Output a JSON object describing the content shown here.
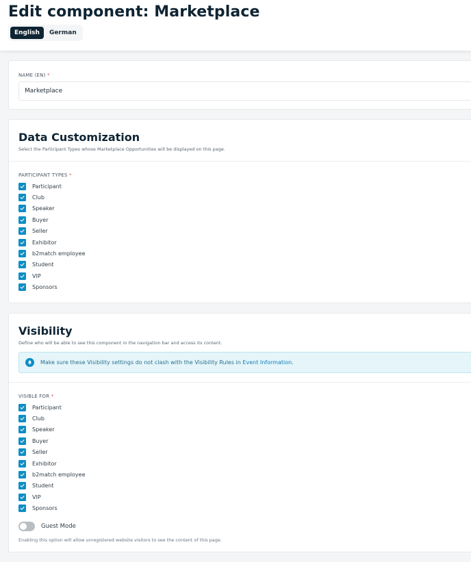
{
  "header": {
    "title": "Edit component: Marketplace",
    "languages": [
      {
        "label": "English",
        "active": true
      },
      {
        "label": "German",
        "active": false
      }
    ]
  },
  "name_field": {
    "label": "NAME (EN)",
    "required_mark": "*",
    "value": "Marketplace"
  },
  "data_customization": {
    "title": "Data Customization",
    "description": "Select the Participant Types whose Marketplace Opportunities will be displayed on this page.",
    "field_label": "PARTICIPANT TYPES",
    "required_mark": "*",
    "items": [
      {
        "label": "Participant",
        "checked": true
      },
      {
        "label": "Club",
        "checked": true
      },
      {
        "label": "Speaker",
        "checked": true
      },
      {
        "label": "Buyer",
        "checked": true
      },
      {
        "label": "Seller",
        "checked": true
      },
      {
        "label": "Exhibitor",
        "checked": true
      },
      {
        "label": "b2match employee",
        "checked": true
      },
      {
        "label": "Student",
        "checked": true
      },
      {
        "label": "VIP",
        "checked": true
      },
      {
        "label": "Sponsors",
        "checked": true
      }
    ]
  },
  "visibility": {
    "title": "Visibility",
    "description": "Define who will be able to see this component in the navigation bar and access its content.",
    "alert": {
      "icon": "bell-icon",
      "text": "Make sure these Visibility settings do not clash with the Visibility Rules in ",
      "link": "Event Information",
      "suffix": "."
    },
    "field_label": "VISIBLE FOR",
    "required_mark": "*",
    "items": [
      {
        "label": "Participant",
        "checked": true
      },
      {
        "label": "Club",
        "checked": true
      },
      {
        "label": "Speaker",
        "checked": true
      },
      {
        "label": "Buyer",
        "checked": true
      },
      {
        "label": "Seller",
        "checked": true
      },
      {
        "label": "Exhibitor",
        "checked": true
      },
      {
        "label": "b2match employee",
        "checked": true
      },
      {
        "label": "Student",
        "checked": true
      },
      {
        "label": "VIP",
        "checked": true
      },
      {
        "label": "Sponsors",
        "checked": true
      }
    ],
    "guest_mode": {
      "label": "Guest Mode",
      "enabled": false,
      "help": "Enabling this option will allow unregistered website visitors to see the content of this page."
    }
  },
  "colors": {
    "accent": "#0d8ec5",
    "primary_dark": "#0f2433",
    "required": "#d9534f"
  }
}
